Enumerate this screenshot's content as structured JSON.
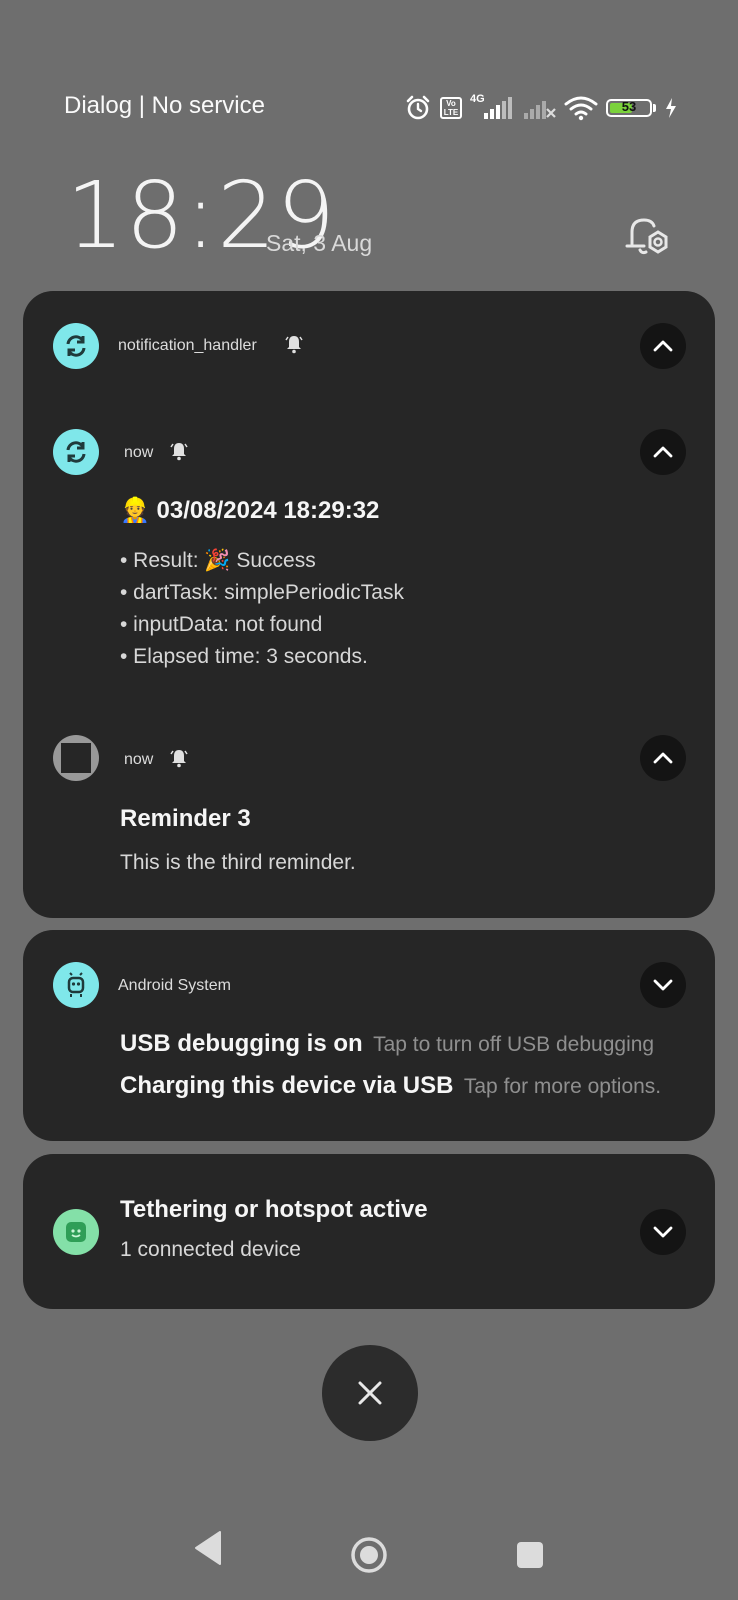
{
  "status_bar": {
    "carrier": "Dialog | No service",
    "network_type": "4G",
    "volte_label": "Vo LTE",
    "battery_level": "53",
    "icons": [
      "alarm-icon",
      "volte-icon",
      "signal-icon",
      "no-signal-icon",
      "wifi-icon",
      "battery-icon",
      "charging-icon"
    ]
  },
  "lockscreen": {
    "time": "18:29",
    "date": "Sat, 3 Aug"
  },
  "notifications": {
    "group1": {
      "app_name": "notification_handler",
      "items": [
        {
          "time": "now",
          "title": "👷 03/08/2024 18:29:32",
          "lines": [
            "• Result: 🎉 Success",
            "• dartTask: simplePeriodicTask",
            "• inputData: not found",
            "• Elapsed time: 3 seconds."
          ]
        },
        {
          "time": "now",
          "title": "Reminder 3",
          "text": "This is the third reminder."
        }
      ]
    },
    "group2": {
      "app_name": "Android System",
      "rows": [
        {
          "title": "USB debugging is on",
          "subtitle": "Tap to turn off USB debugging"
        },
        {
          "title": "Charging this device via USB",
          "subtitle": "Tap for more options."
        }
      ]
    },
    "group3": {
      "title": "Tethering or hotspot active",
      "text": "1 connected device"
    }
  },
  "colors": {
    "background": "#6e6e6e",
    "card": "#262626",
    "app_icon_accent": "#7fe7ea",
    "battery_fill": "#7bd23c"
  }
}
